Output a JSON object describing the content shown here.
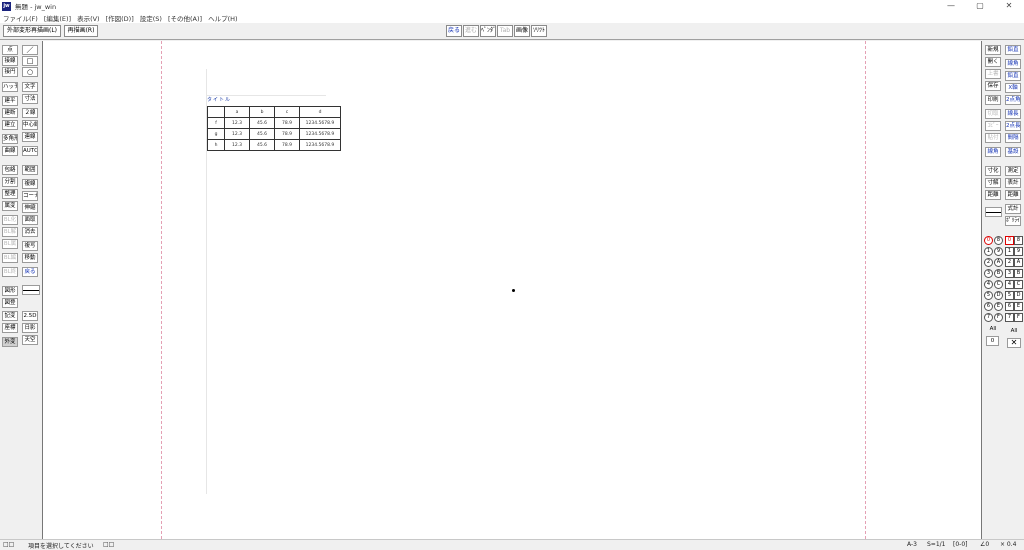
{
  "window": {
    "app_icon_text": "jw",
    "title": "無題 - jw_win",
    "controls": [
      "—",
      "▢",
      "✕"
    ]
  },
  "menu": [
    "ファイル(F)",
    "[編集(E)]",
    "表示(V)",
    "[作図(D)]",
    "設定(S)",
    "[その他(A)]",
    "ヘルプ(H)"
  ],
  "toolbar": {
    "external_redraw": "外部変形再描画(L)",
    "redraw": "再描画(R)",
    "back": "戻る",
    "forward": "進む",
    "pen": "ﾍﾟﾝﾀﾞ",
    "disabled_btn": "Tab",
    "image": "画像",
    "spacer_label": "ｿﾘﾂﾄ"
  },
  "left_palette": {
    "col1": [
      "点",
      "接線",
      "接円",
      "ハッチ",
      "建平",
      "建断",
      "建立",
      "多角形",
      "曲線",
      "包絡",
      "分割",
      "整理",
      "属変",
      "BL化",
      "BL解",
      "BL属",
      "BL編",
      "BL終",
      "図形",
      "図登",
      "記変",
      "座標",
      "外変"
    ],
    "col2": [
      "／",
      "□",
      "○",
      "文字",
      "寸法",
      "２線",
      "中心線",
      "連線",
      "AUTO",
      "範囲",
      "複線",
      "コーナー",
      "伸縮",
      "面取",
      "消去",
      "複写",
      "移動",
      "戻る",
      "2.5D",
      "日影",
      "天空"
    ]
  },
  "right_palette": {
    "col1": [
      "新規",
      "開く",
      "上書",
      "保存",
      "印刷",
      "切取",
      "ｺﾋﾟｰ",
      "貼付",
      "線角",
      "寸化",
      "寸解",
      "距離",
      "線属"
    ],
    "col2": [
      "鉛直",
      "線角",
      "鉛直",
      "X軸",
      "2点角",
      "線長",
      "2点長",
      "間隔",
      "基設",
      "測定",
      "表計",
      "距離",
      "式計",
      "ﾎﾟﾘﾗｲﾝ"
    ],
    "layer_groups_left": [
      "0",
      "1",
      "2",
      "3",
      "4",
      "5",
      "6",
      "7"
    ],
    "layer_groups_circled": [
      "8",
      "9",
      "A",
      "B",
      "C",
      "D",
      "E",
      "F"
    ],
    "layers_left": [
      "0",
      "1",
      "2",
      "3",
      "4",
      "5",
      "6",
      "7"
    ],
    "layers_right": [
      "8",
      "9",
      "A",
      "B",
      "C",
      "D",
      "E",
      "F"
    ],
    "all_label_1": "All",
    "all_value_1": "0",
    "all_label_2": "All"
  },
  "drawing": {
    "title_label": "タイトル",
    "table": {
      "header": [
        "",
        "a",
        "b",
        "c",
        "d"
      ],
      "rows": [
        [
          "f",
          "12.3",
          "45.6",
          "78.9",
          "1234.5678.9"
        ],
        [
          "g",
          "12.3",
          "45.6",
          "78.9",
          "1234.5678.9"
        ],
        [
          "h",
          "12.3",
          "45.6",
          "78.9",
          "1234.5678.9"
        ]
      ]
    }
  },
  "status": {
    "left_prefix": "□□",
    "message": "項目を選択してください",
    "left_suffix": "□□",
    "paper": "A-3",
    "scale": "S=1/1",
    "layer": "[0-0]",
    "angle": "∠0",
    "factor": "× 0.4"
  },
  "colors": {
    "accent_blue": "#1533b5",
    "guide_pink": "#e4a0b4",
    "active_layer_red": "#dd0000"
  }
}
